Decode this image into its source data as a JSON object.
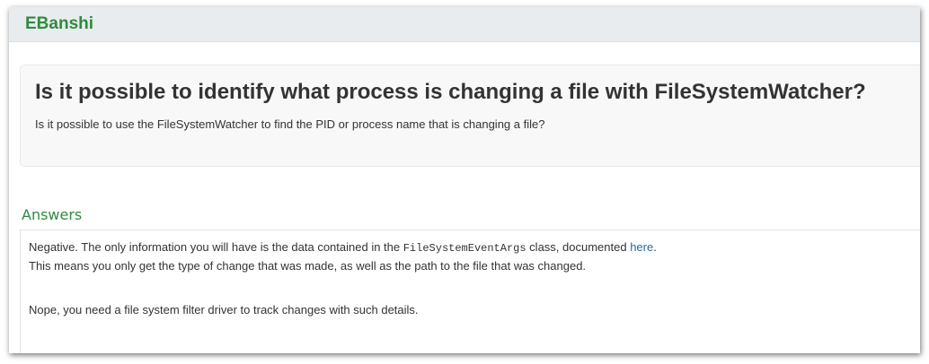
{
  "header": {
    "brand": "EBanshi"
  },
  "question": {
    "title": "Is it possible to identify what process is changing a file with FileSystemWatcher?",
    "body": "Is it possible to use the FileSystemWatcher to find the PID or process name that is changing a file?"
  },
  "answers": {
    "heading": "Answers",
    "items": [
      {
        "line1_before": "Negative. The only information you will have is the data contained in the ",
        "line1_code": "FileSystemEventArgs",
        "line1_middle": " class, documented ",
        "line1_link": "here",
        "line1_after": ".",
        "line2": "This means you only get the type of change that was made, as well as the path to the file that was changed."
      },
      {
        "text": "Nope, you need a file system filter driver to track changes with such details."
      }
    ]
  },
  "colors": {
    "brand": "#2e8b3e",
    "link": "#2a6a9e",
    "header_bg": "#e9ecef",
    "question_bg": "#f8f8f8",
    "text": "#333333"
  }
}
